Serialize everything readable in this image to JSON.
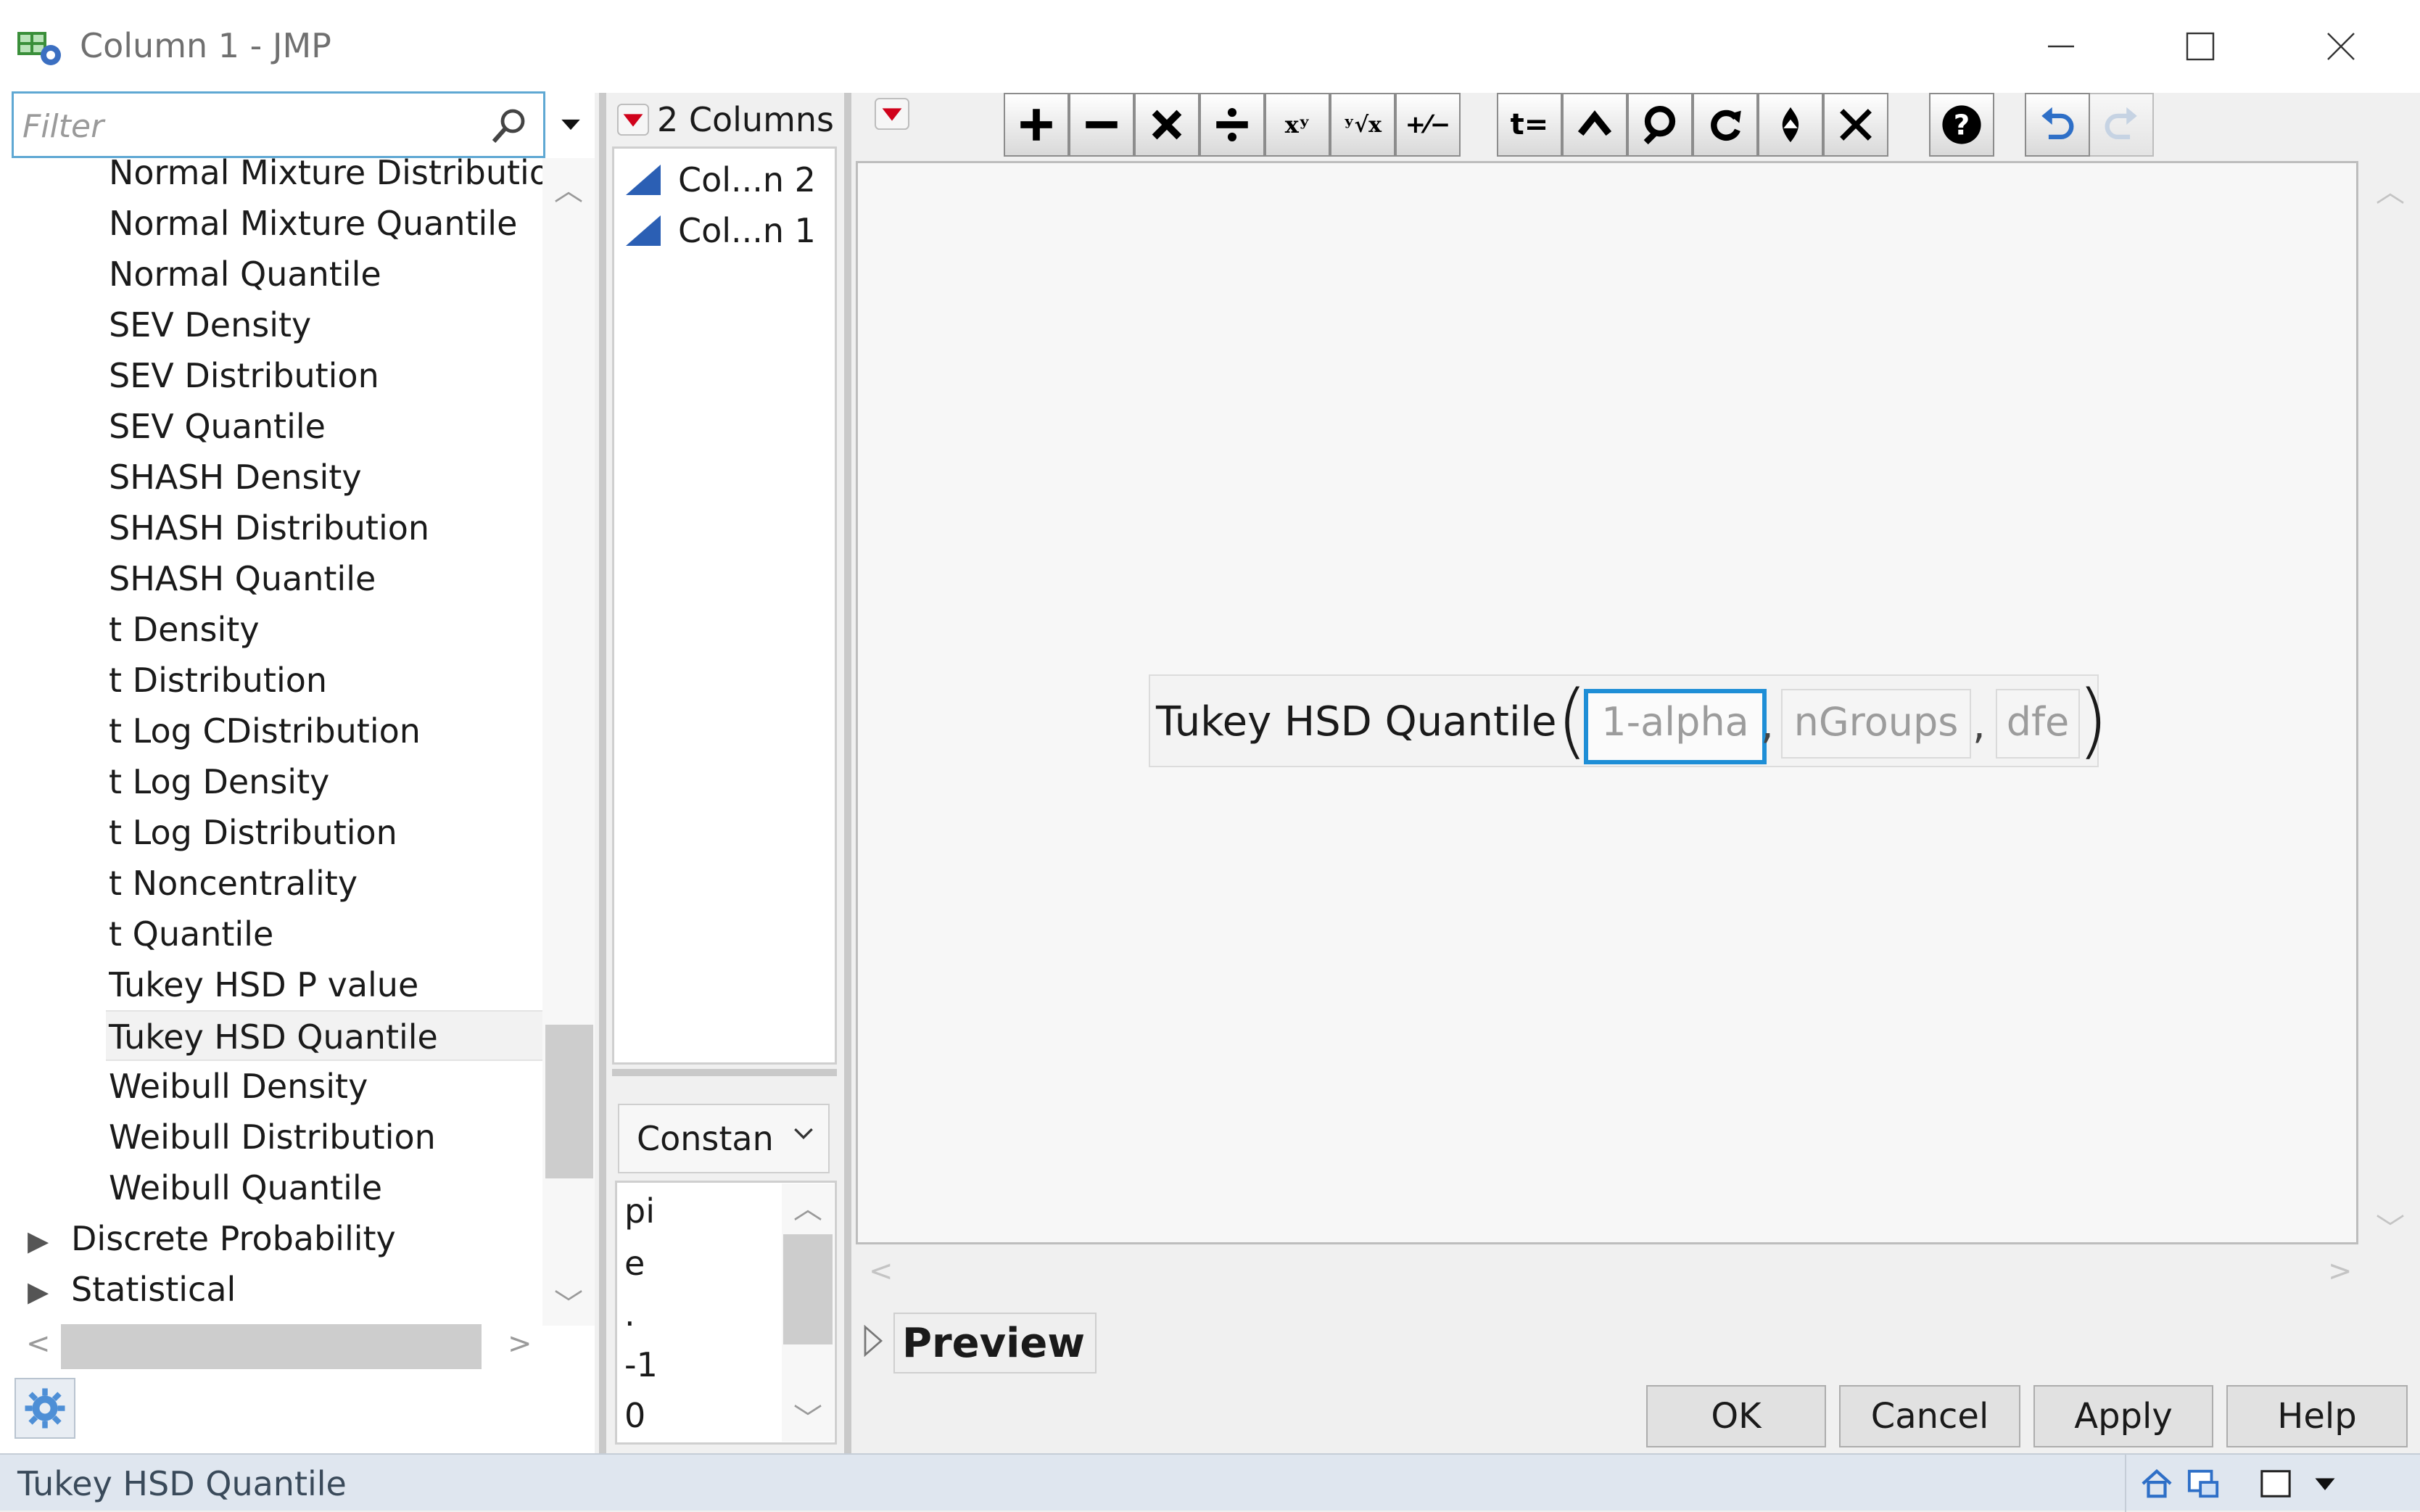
{
  "window": {
    "title": "Column 1 - JMP",
    "controls": [
      "minimize",
      "maximize",
      "close"
    ]
  },
  "filter": {
    "placeholder": "Filter",
    "search_icon": "search-icon",
    "menu_icon": "dropdown-triangle-icon"
  },
  "function_list": {
    "items": [
      "Normal Mixture Distribution",
      "Normal Mixture Quantile",
      "Normal Quantile",
      "SEV Density",
      "SEV Distribution",
      "SEV Quantile",
      "SHASH Density",
      "SHASH Distribution",
      "SHASH Quantile",
      "t Density",
      "t Distribution",
      "t Log CDistribution",
      "t Log Density",
      "t Log Distribution",
      "t Noncentrality",
      "t Quantile",
      "Tukey HSD P value",
      "Tukey HSD Quantile",
      "Weibull Density",
      "Weibull Distribution",
      "Weibull Quantile"
    ],
    "selected": "Tukey HSD Quantile",
    "categories": [
      "Discrete Probability",
      "Statistical"
    ]
  },
  "columns": {
    "header": "2 Columns",
    "items": [
      "Col...n 2",
      "Col...n 1"
    ]
  },
  "constants": {
    "selected": "Constan",
    "items": [
      "pi",
      "e",
      ".",
      "-1",
      "0"
    ]
  },
  "toolbar": {
    "buttons": [
      "add-icon",
      "subtract-icon",
      "multiply-icon",
      "divide-icon",
      "power-icon",
      "root-icon",
      "negate-icon",
      "assign-icon",
      "unary-minus-icon",
      "local-variable-icon",
      "swap-icon",
      "peel-icon",
      "delete-icon",
      "help-icon",
      "undo-icon",
      "redo-icon"
    ],
    "assign_label": "t=",
    "power_label": "xʸ",
    "root_label": "ʸ√x",
    "negate_label": "+⁄−"
  },
  "formula": {
    "function_name": "Tukey HSD Quantile",
    "args": [
      "1-alpha",
      "nGroups",
      "dfe"
    ],
    "active_arg": "1-alpha",
    "comma": ","
  },
  "preview": {
    "label": "Preview"
  },
  "buttons": {
    "ok": "OK",
    "cancel": "Cancel",
    "apply": "Apply",
    "help": "Help"
  },
  "status": {
    "text": "Tukey HSD Quantile"
  },
  "colors": {
    "accent": "#1e8ed6",
    "filter_border": "#5fa8d3",
    "menu_red": "#d0021b",
    "column_icon_blue": "#2b5fb4"
  }
}
